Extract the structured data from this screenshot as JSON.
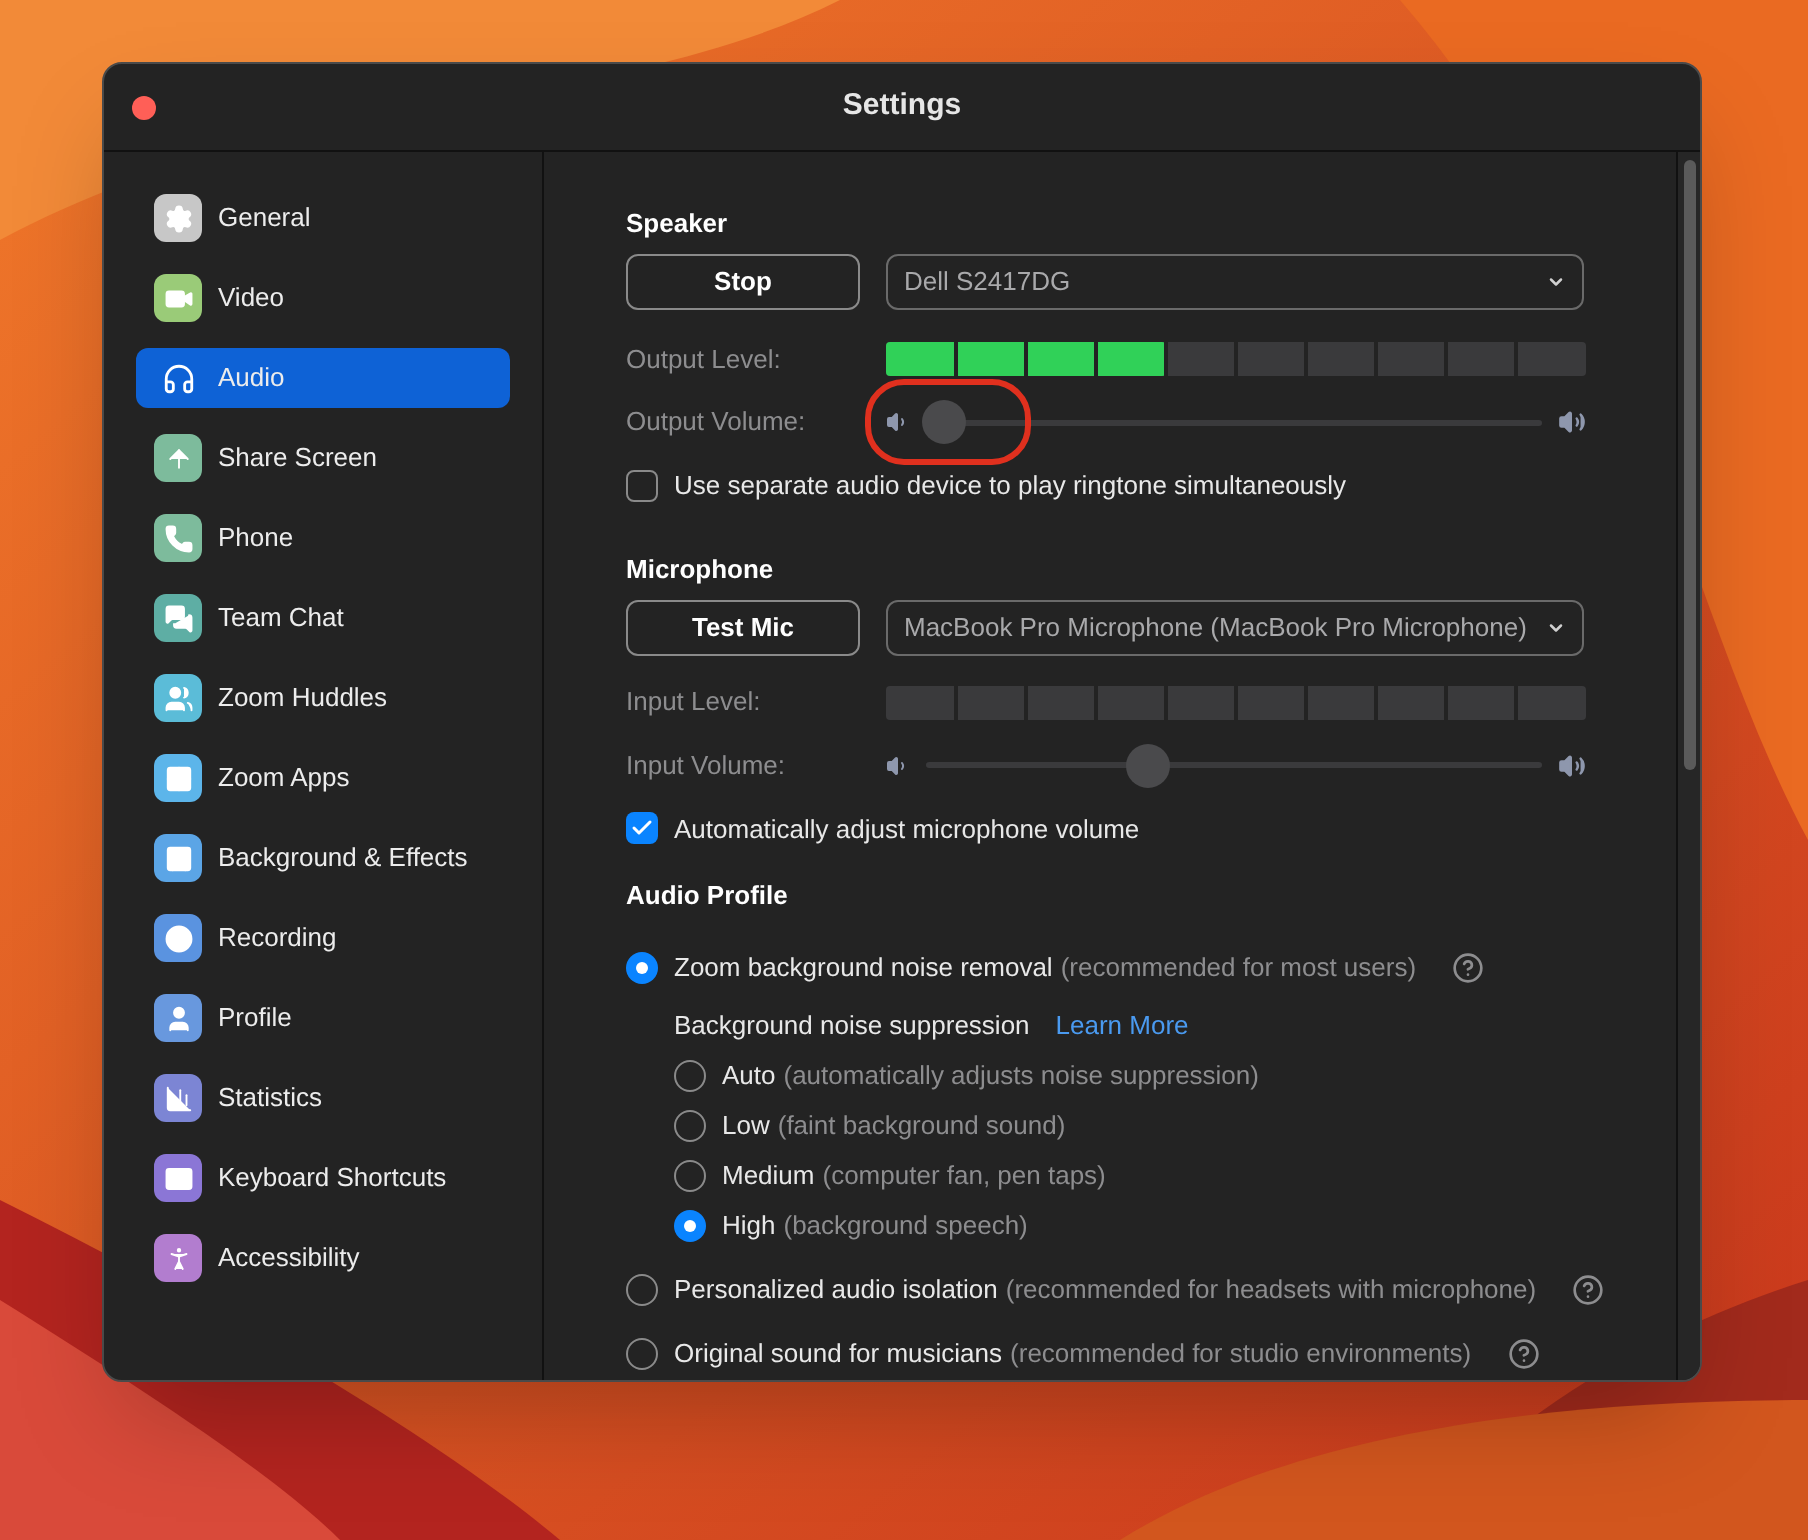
{
  "window": {
    "title": "Settings"
  },
  "sidebar": {
    "items": [
      {
        "label": "General",
        "selected": false,
        "color": "#c7c7c7"
      },
      {
        "label": "Video",
        "selected": false,
        "color": "#9acb78"
      },
      {
        "label": "Audio",
        "selected": true
      },
      {
        "label": "Share Screen",
        "selected": false,
        "color": "#7dbb9c"
      },
      {
        "label": "Phone",
        "selected": false,
        "color": "#7dbb9c"
      },
      {
        "label": "Team Chat",
        "selected": false,
        "color": "#5eaea4"
      },
      {
        "label": "Zoom Huddles",
        "selected": false,
        "color": "#5bbcd8"
      },
      {
        "label": "Zoom Apps",
        "selected": false,
        "color": "#5cb5ea"
      },
      {
        "label": "Background & Effects",
        "selected": false,
        "color": "#5ba5e6"
      },
      {
        "label": "Recording",
        "selected": false,
        "color": "#5a93e0"
      },
      {
        "label": "Profile",
        "selected": false,
        "color": "#6898de"
      },
      {
        "label": "Statistics",
        "selected": false,
        "color": "#7c85d4"
      },
      {
        "label": "Keyboard Shortcuts",
        "selected": false,
        "color": "#8b76d6"
      },
      {
        "label": "Accessibility",
        "selected": false,
        "color": "#b27dcf"
      }
    ]
  },
  "speaker": {
    "heading": "Speaker",
    "button": "Stop",
    "device": "Dell S2417DG",
    "level_label": "Output Level:",
    "output_level": {
      "level": 0.4
    },
    "volume_label": "Output Volume:",
    "volume": {
      "level": 0.03,
      "highlighted": true
    },
    "checkbox": {
      "label": "Use separate audio device to play ringtone simultaneously",
      "checked": false
    }
  },
  "microphone": {
    "heading": "Microphone",
    "button": "Test Mic",
    "device": "MacBook Pro Microphone (MacBook Pro Microphone)",
    "level_label": "Input Level:",
    "volume_label": "Input Volume:",
    "volume": {
      "level": 0.36
    },
    "checkbox": {
      "label": "Automatically adjust microphone volume",
      "checked": true
    }
  },
  "audio_profile": {
    "heading": "Audio Profile",
    "options": [
      {
        "label": "Zoom background noise removal",
        "note": "(recommended for most users)",
        "selected": true,
        "help": true
      },
      {
        "label": "Personalized audio isolation",
        "note": "(recommended for headsets with microphone)",
        "selected": false,
        "help": true
      },
      {
        "label": "Original sound for musicians",
        "note": "(recommended for studio environments)",
        "selected": false,
        "help": true
      }
    ],
    "suppression": {
      "label": "Background noise suppression",
      "link": "Learn More",
      "options": [
        {
          "label": "Auto",
          "note": "(automatically adjusts noise suppression)",
          "selected": false
        },
        {
          "label": "Low",
          "note": "(faint background sound)",
          "selected": false
        },
        {
          "label": "Medium",
          "note": "(computer fan, pen taps)",
          "selected": false
        },
        {
          "label": "High",
          "note": "(background speech)",
          "selected": true
        }
      ]
    }
  }
}
